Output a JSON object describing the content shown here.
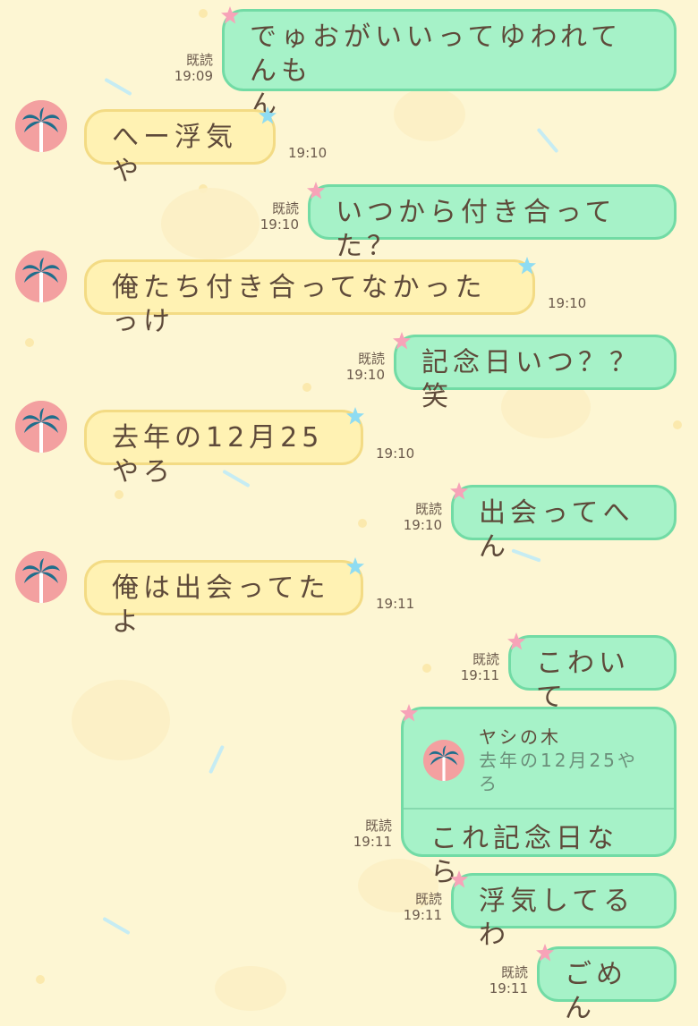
{
  "chat": {
    "colors": {
      "background": "#fdf6d3",
      "outgoing_bubble": "#a6f2c8",
      "outgoing_border": "#72dba5",
      "incoming_bubble": "#fff2b3",
      "incoming_border": "#f3db84",
      "avatar_bg": "#f3a0a0",
      "palm": "#1f6e8c"
    },
    "read_label": "既読",
    "messages": [
      {
        "dir": "out",
        "text_line1": "でゅおがいいってゆわれてんも",
        "text_line2": "ん",
        "time": "19:09"
      },
      {
        "dir": "in",
        "text": "へー浮気や",
        "time": "19:10",
        "avatar_icon": "palm-tree-icon"
      },
      {
        "dir": "out",
        "text": "いつから付き合ってた？",
        "time": "19:10"
      },
      {
        "dir": "in",
        "text": "俺たち付き合ってなかったっけ",
        "time": "19:10",
        "avatar_icon": "palm-tree-icon"
      },
      {
        "dir": "out",
        "text": "記念日いつ？？笑",
        "time": "19:10"
      },
      {
        "dir": "in",
        "text": "去年の12月25やろ",
        "time": "19:10",
        "avatar_icon": "palm-tree-icon"
      },
      {
        "dir": "out",
        "text": "出会ってへん",
        "time": "19:10"
      },
      {
        "dir": "in",
        "text": "俺は出会ってたよ",
        "time": "19:11",
        "avatar_icon": "palm-tree-icon"
      },
      {
        "dir": "out",
        "text": "こわいて",
        "time": "19:11"
      },
      {
        "dir": "out",
        "reply_name": "ヤシの木",
        "reply_quote": "去年の12月25やろ",
        "text": "これ記念日なら",
        "time": "19:11"
      },
      {
        "dir": "out",
        "text": "浮気してるわ",
        "time": "19:11"
      },
      {
        "dir": "out",
        "text": "ごめん",
        "time": "19:11"
      }
    ]
  }
}
